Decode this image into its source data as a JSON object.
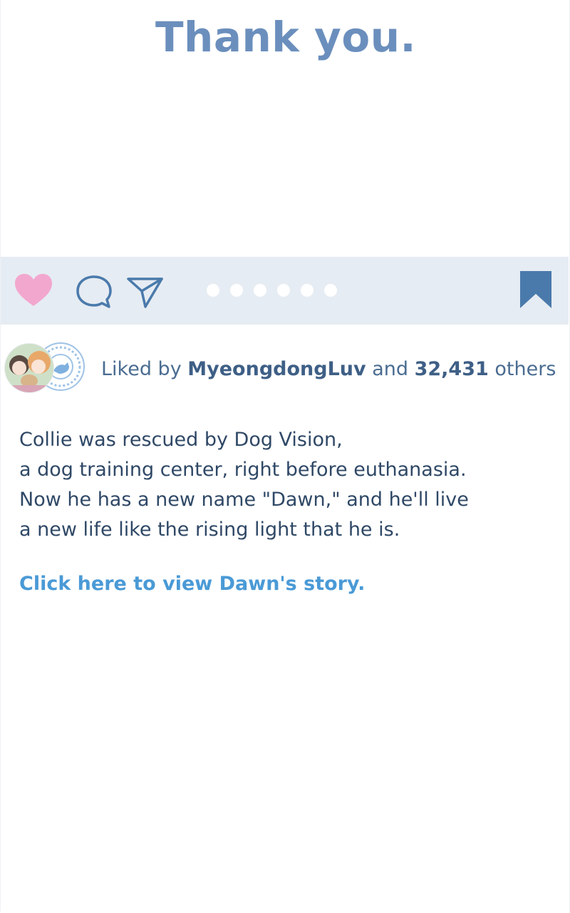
{
  "header": {
    "title": "Thank you."
  },
  "action_bar": {
    "icons": {
      "like": "heart-icon",
      "comment": "comment-icon",
      "share": "paper-plane-icon",
      "save": "bookmark-icon"
    },
    "carousel": {
      "total": 6,
      "active_index": 0
    },
    "colors": {
      "bar_background": "#e6ecf3",
      "heart": "#f2a7cf",
      "outline": "#4a7aab",
      "bookmark": "#4a7aab"
    }
  },
  "likes": {
    "prefix": "Liked by",
    "user": "MyeongdongLuv",
    "connector": "and",
    "count": "32,431",
    "suffix": "others"
  },
  "caption": {
    "lines": [
      "Collie was rescued by Dog Vision,",
      "a dog training center, right before euthanasia.",
      "Now he has a new name \"Dawn,\" and he'll live",
      "a new life like the rising light that he is."
    ]
  },
  "link": {
    "label": "Click here to view Dawn's story."
  }
}
